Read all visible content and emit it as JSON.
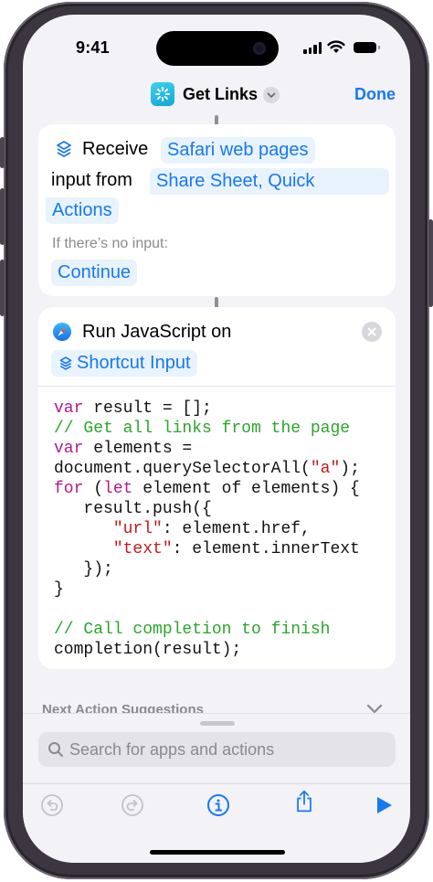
{
  "status": {
    "time": "9:41"
  },
  "nav": {
    "title": "Get Links",
    "done_label": "Done",
    "icon": "shortcuts-app-icon"
  },
  "receive_card": {
    "receive_word": "Receive",
    "input_type": "Safari web pages",
    "input_from_label": "input from",
    "source_line1": "Share Sheet, Quick",
    "source_line2": "Actions",
    "no_input_label": "If there’s no input:",
    "no_input_action": "Continue"
  },
  "js_card": {
    "title": "Run JavaScript on",
    "input_token": "Shortcut Input",
    "code_lines": [
      "var result = [];",
      "// Get all links from the page",
      "var elements =",
      "document.querySelectorAll(\"a\");",
      "for (let element of elements) {",
      "   result.push({",
      "      \"url\": element.href,",
      "      \"text\": element.innerText",
      "   });",
      "}",
      "",
      "// Call completion to finish",
      "completion(result);"
    ]
  },
  "suggestions": {
    "label": "Next Action Suggestions"
  },
  "search": {
    "placeholder": "Search for apps and actions"
  },
  "toolbar": {
    "undo": "undo-icon",
    "redo": "redo-icon",
    "info": "info-icon",
    "share": "share-icon",
    "run": "play-icon"
  },
  "colors": {
    "accent": "#1778f2",
    "token_bg": "#e9f3fd",
    "keyword": "#b5178c",
    "comment": "#2aa52a",
    "string": "#c41a16"
  }
}
